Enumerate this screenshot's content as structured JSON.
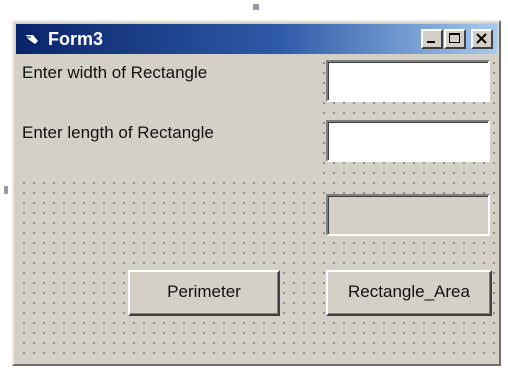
{
  "window": {
    "title": "Form3"
  },
  "title_buttons": {
    "minimize_icon": "minimize-icon",
    "maximize_icon": "maximize-icon",
    "close_icon": "close-icon"
  },
  "labels": {
    "width": "Enter width of Rectangle",
    "length": "Enter length of Rectangle"
  },
  "inputs": {
    "width_value": "",
    "length_value": "",
    "result_value": ""
  },
  "buttons": {
    "perimeter": "Perimeter",
    "area": "Rectangle_Area"
  },
  "colors": {
    "title_start": "#0a246a",
    "title_end": "#a6caf0",
    "form_background": "#d4d0c8"
  }
}
